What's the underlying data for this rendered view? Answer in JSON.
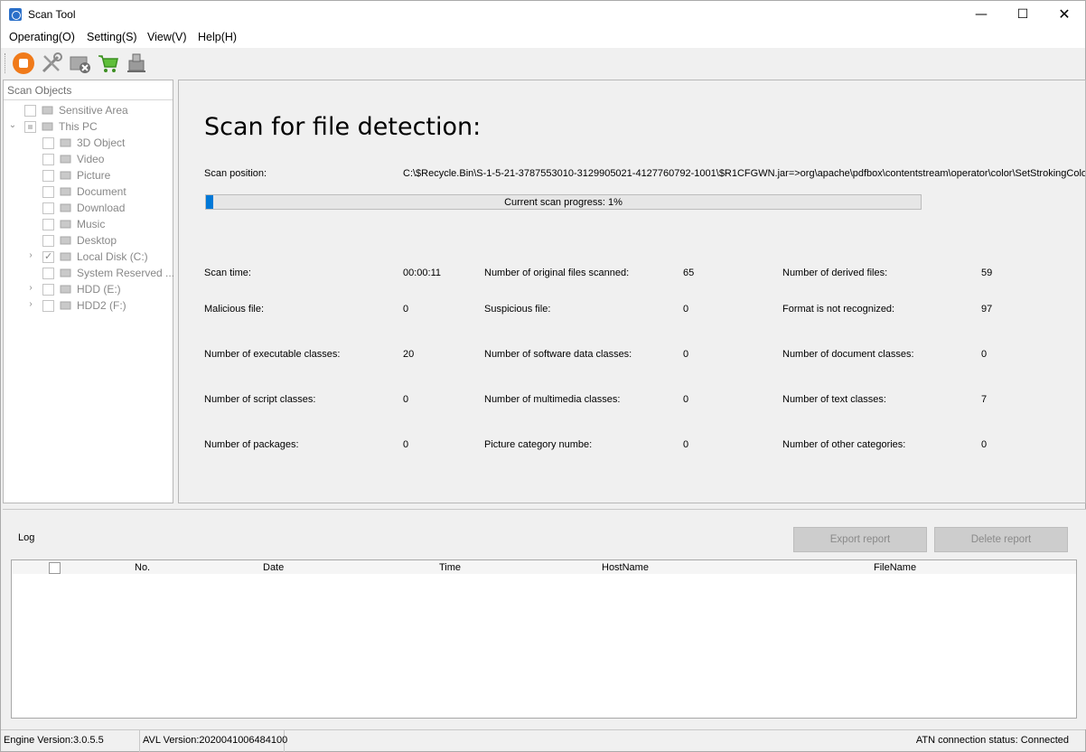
{
  "window": {
    "title": "Scan Tool",
    "minimize": "—",
    "maximize": "☐",
    "close": "✕"
  },
  "menu": [
    "Operating(O)",
    "Setting(S)",
    "View(V)",
    "Help(H)"
  ],
  "toolbar": {
    "icons": [
      "stop-scan-icon",
      "tools-icon",
      "clear-icon",
      "cart-icon",
      "export-icon"
    ],
    "accent": "#f07a1a"
  },
  "scan_objects": {
    "header": "Scan Objects",
    "items": [
      {
        "label": "Sensitive Area",
        "icon": "sensitive-area-icon",
        "level": 0,
        "expander": "",
        "checked": "none"
      },
      {
        "label": "This PC",
        "icon": "pc-icon",
        "level": 0,
        "expander": "⌄",
        "checked": "partial"
      },
      {
        "label": "3D Object",
        "icon": "3d-object-icon",
        "level": 1,
        "expander": "",
        "checked": "none"
      },
      {
        "label": "Video",
        "icon": "video-icon",
        "level": 1,
        "expander": "",
        "checked": "none"
      },
      {
        "label": "Picture",
        "icon": "picture-icon",
        "level": 1,
        "expander": "",
        "checked": "none"
      },
      {
        "label": "Document",
        "icon": "document-icon",
        "level": 1,
        "expander": "",
        "checked": "none"
      },
      {
        "label": "Download",
        "icon": "download-icon",
        "level": 1,
        "expander": "",
        "checked": "none"
      },
      {
        "label": "Music",
        "icon": "music-icon",
        "level": 1,
        "expander": "",
        "checked": "none"
      },
      {
        "label": "Desktop",
        "icon": "desktop-icon",
        "level": 1,
        "expander": "",
        "checked": "none"
      },
      {
        "label": "Local Disk (C:)",
        "icon": "drive-icon",
        "level": 1,
        "expander": "›",
        "checked": "checked"
      },
      {
        "label": "System Reserved ...",
        "icon": "drive-icon",
        "level": 1,
        "expander": "",
        "checked": "none"
      },
      {
        "label": "HDD (E:)",
        "icon": "drive-icon",
        "level": 1,
        "expander": "›",
        "checked": "none"
      },
      {
        "label": "HDD2 (F:)",
        "icon": "drive-icon",
        "level": 1,
        "expander": "›",
        "checked": "none"
      }
    ]
  },
  "scan": {
    "title": "Scan for file detection:",
    "position_label": "Scan position:",
    "position_value": "C:\\$Recycle.Bin\\S-1-5-21-3787553010-3129905021-4127760792-1001\\$R1CFGWN.jar=>org\\apache\\pdfbox\\contentstream\\operator\\color\\SetStrokingColor.class",
    "progress_text": "Current scan progress: 1%",
    "progress_fraction": 0.01,
    "progress_color": "#0078d7",
    "stats": [
      [
        {
          "label": "Scan time:",
          "value": "00:00:11"
        },
        {
          "label": "Number of original files scanned:",
          "value": "65"
        },
        {
          "label": "Number of derived files:",
          "value": "59"
        }
      ],
      [
        {
          "label": "Malicious file:",
          "value": "0"
        },
        {
          "label": "Suspicious file:",
          "value": "0"
        },
        {
          "label": "Format is not recognized:",
          "value": "97"
        }
      ],
      [
        {
          "label": "Number of executable classes:",
          "value": "20"
        },
        {
          "label": "Number of software data classes:",
          "value": "0"
        },
        {
          "label": "Number of document classes:",
          "value": "0"
        }
      ],
      [
        {
          "label": "Number of script classes:",
          "value": "0"
        },
        {
          "label": "Number of multimedia classes:",
          "value": "0"
        },
        {
          "label": "Number of text classes:",
          "value": "7"
        }
      ],
      [
        {
          "label": "Number of packages:",
          "value": "0"
        },
        {
          "label": "Picture category numbe:",
          "value": "0"
        },
        {
          "label": "Number of other categories:",
          "value": "0"
        }
      ]
    ]
  },
  "log": {
    "label": "Log",
    "export_button": "Export report",
    "delete_button": "Delete report",
    "columns": [
      "No.",
      "Date",
      "Time",
      "HostName",
      "FileName"
    ]
  },
  "status": {
    "engine": "Engine Version:3.0.5.5",
    "avl": "AVL Version:2020041006484100",
    "atn": "ATN connection status: Connected"
  }
}
